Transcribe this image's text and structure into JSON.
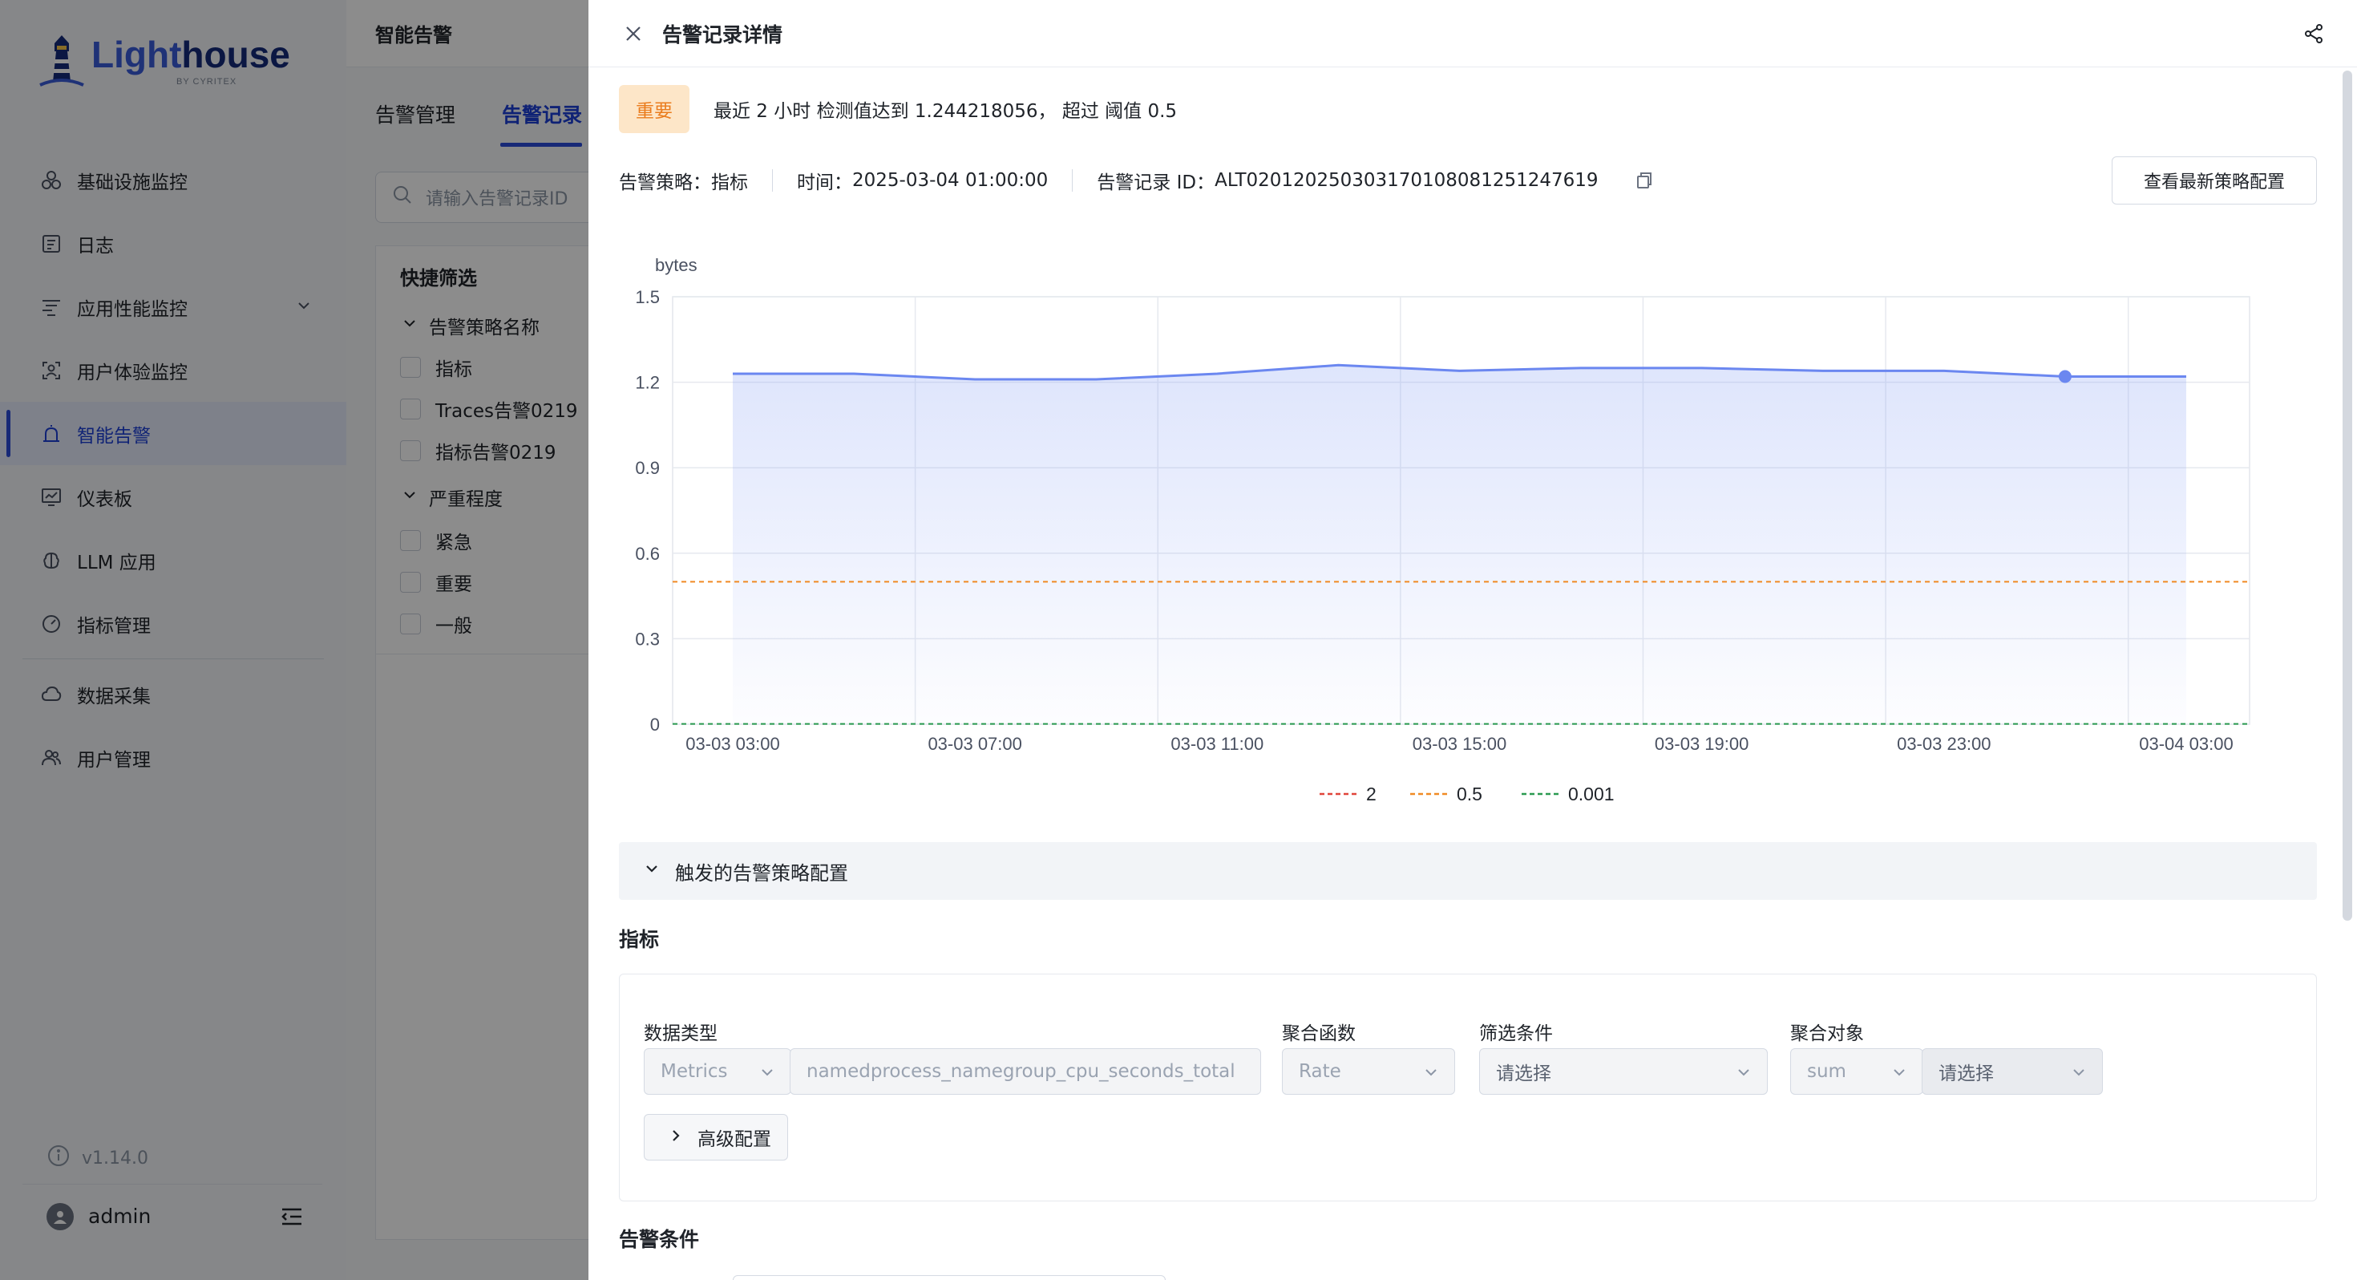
{
  "app": {
    "logo_light": "Light",
    "logo_house": "house",
    "logo_sub": "BY CYRITEX",
    "nav": [
      {
        "label": "基础设施监控",
        "icon": "infrastructure-icon"
      },
      {
        "label": "日志",
        "icon": "log-icon"
      },
      {
        "label": "应用性能监控",
        "icon": "apm-icon"
      },
      {
        "label": "用户体验监控",
        "icon": "user-experience-icon"
      },
      {
        "label": "智能告警",
        "icon": "alert-icon"
      },
      {
        "label": "仪表板",
        "icon": "dashboard-icon"
      },
      {
        "label": "LLM 应用",
        "icon": "llm-icon"
      },
      {
        "label": "指标管理",
        "icon": "metric-icon"
      },
      {
        "label": "数据采集",
        "icon": "data-collect-icon"
      },
      {
        "label": "用户管理",
        "icon": "user-manage-icon"
      }
    ],
    "active_nav": "智能告警",
    "version": "v1.14.0",
    "username": "admin"
  },
  "main": {
    "title": "智能告警",
    "tabs": [
      "告警管理",
      "告警记录"
    ],
    "active_tab": "告警记录",
    "search_placeholder": "请输入告警记录ID",
    "filter_title": "快捷筛选",
    "groups": [
      {
        "title": "告警策略名称",
        "items": [
          "指标",
          "Traces告警0219",
          "指标告警0219"
        ]
      },
      {
        "title": "严重程度",
        "items": [
          "紧急",
          "重要",
          "一般"
        ]
      }
    ]
  },
  "drawer": {
    "title": "告警记录详情",
    "severity": "重要",
    "alert_message": "最近 2 小时 检测值达到 1.244218056， 超过 阈值 0.5",
    "policy_label": "告警策略：",
    "policy_value": "指标",
    "time_label": "时间：",
    "time_value": "2025-03-04 01:00:00",
    "record_id_label": "告警记录 ID：",
    "record_id_value": "ALT020120250303170108081251247619",
    "latest_config_button": "查看最新策略配置",
    "config_section": "触发的告警策略配置",
    "metric_section": "指标",
    "fields": {
      "data_type_label": "数据类型",
      "data_type_value": "Metrics",
      "metric_name": "namedprocess_namegroup_cpu_seconds_total",
      "agg_func_label": "聚合函数",
      "agg_func_value": "Rate",
      "filter_label": "筛选条件",
      "filter_placeholder": "请选择",
      "agg_target_label": "聚合对象",
      "agg_target_value": "sum",
      "agg_target_placeholder": "请选择"
    },
    "advanced_button": "高级配置",
    "condition_section": "告警条件"
  },
  "chart_data": {
    "type": "line",
    "ylabel": "bytes",
    "ylim": [
      0,
      1.5
    ],
    "yticks": [
      "0",
      "0.3",
      "0.6",
      "0.9",
      "1.2",
      "1.5"
    ],
    "xticks": [
      "03-03 03:00",
      "03-03 07:00",
      "03-03 11:00",
      "03-03 15:00",
      "03-03 19:00",
      "03-03 23:00",
      "03-04 03:00"
    ],
    "grid": true,
    "series": [
      {
        "x_hours": [
          0,
          2,
          4,
          6,
          8,
          10,
          12,
          14,
          16,
          18,
          20,
          22,
          23,
          24
        ],
        "values": [
          1.23,
          1.23,
          1.21,
          1.21,
          1.23,
          1.26,
          1.24,
          1.25,
          1.25,
          1.24,
          1.24,
          1.22,
          1.22,
          1.22
        ],
        "color": "#6b87f0",
        "highlight_index": 11
      }
    ],
    "thresholds": [
      {
        "name": "2",
        "value": 2,
        "color": "#e0453a"
      },
      {
        "name": "0.5",
        "value": 0.5,
        "color": "#f08a24"
      },
      {
        "name": "0.001",
        "value": 0.001,
        "color": "#2a9a50"
      }
    ],
    "legend_position": "bottom-center"
  }
}
